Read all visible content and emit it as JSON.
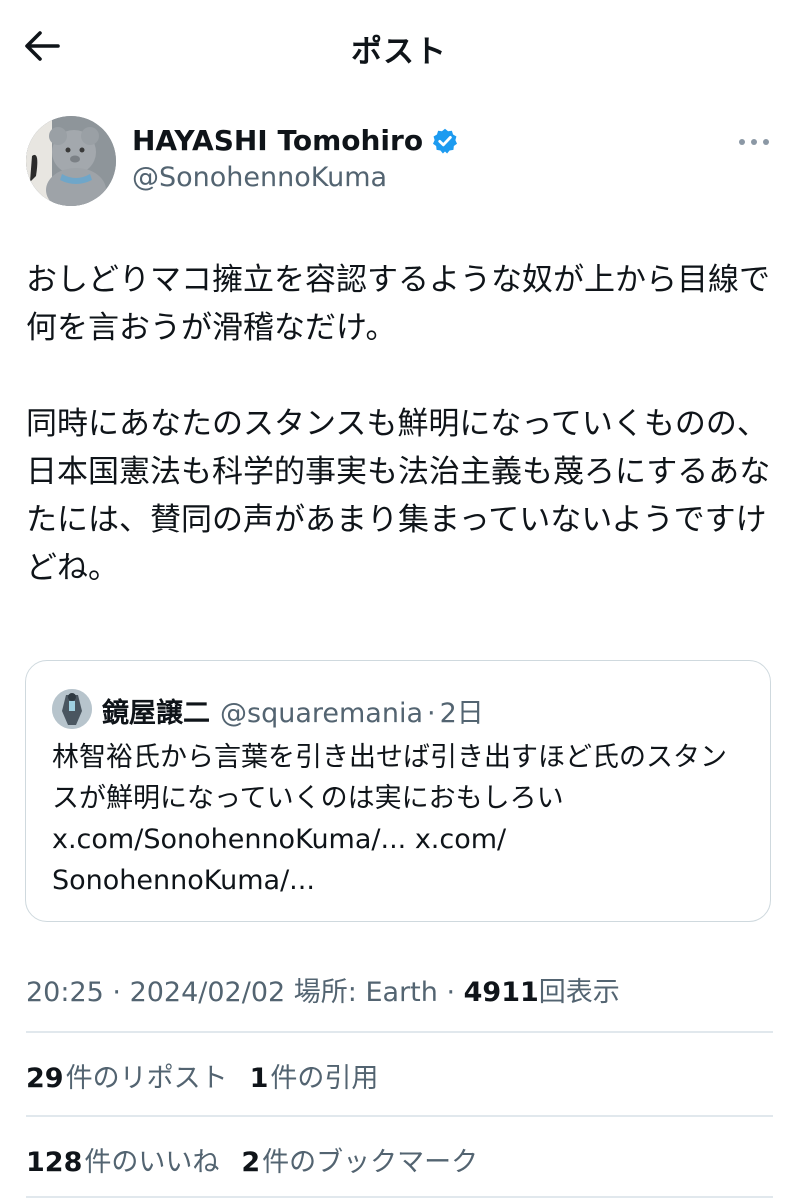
{
  "header": {
    "title": "ポスト",
    "back_icon": "arrow-left-icon"
  },
  "author": {
    "name": "HAYASHI Tomohiro",
    "handle": "@SonohennoKuma",
    "verified": true,
    "verified_color": "#1d9bf0"
  },
  "tweet": {
    "text": "おしどりマコ擁立を容認するような奴が上から目線で何を言おうが滑稽なだけ。\n\n同時にあなたのスタンスも鮮明になっていくものの、日本国憲法も科学的事実も法治主義も蔑ろにするあなたには、賛同の声があまり集まっていないようですけどね。"
  },
  "quote": {
    "name": "鏡屋譲二",
    "handle": "@squaremania",
    "separator": "·",
    "time": "2日",
    "text": "林智裕氏から言葉を引き出せば引き出すほど氏のスタンスが鮮明になっていくのは実におもしろい\nx.com/SonohennoKuma/... x.com/\nSonohennoKuma/..."
  },
  "meta": {
    "time": "20:25",
    "sep1": " · ",
    "date": "2024/02/02",
    "location": "場所: Earth",
    "sep2": " · ",
    "views": "4911",
    "views_label": "回表示"
  },
  "stats": {
    "reposts_num": "29",
    "reposts_label": "件のリポスト",
    "quotes_num": "1",
    "quotes_label": "件の引用",
    "likes_num": "128",
    "likes_label": "件のいいね",
    "bookmarks_num": "2",
    "bookmarks_label": "件のブックマーク"
  }
}
